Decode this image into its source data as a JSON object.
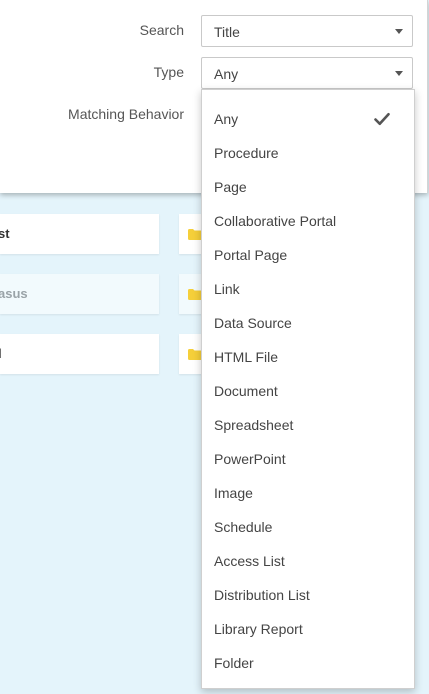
{
  "background_cards": [
    {
      "label": "st"
    },
    {
      "label": "asus"
    },
    {
      "label": "l"
    }
  ],
  "filter_panel": {
    "search_label": "Search",
    "search_value": "Title",
    "type_label": "Type",
    "type_value": "Any",
    "matching_label": "Matching Behavior"
  },
  "type_dropdown": {
    "selected": "Any",
    "options": [
      "Any",
      "Procedure",
      "Page",
      "Collaborative Portal",
      "Portal Page",
      "Link",
      "Data Source",
      "HTML File",
      "Document",
      "Spreadsheet",
      "PowerPoint",
      "Image",
      "Schedule",
      "Access List",
      "Distribution List",
      "Library Report",
      "Folder"
    ]
  },
  "colors": {
    "page_background": "#e4f4fb",
    "folder_icon": "#f5cf3a",
    "check_icon": "#555555"
  }
}
